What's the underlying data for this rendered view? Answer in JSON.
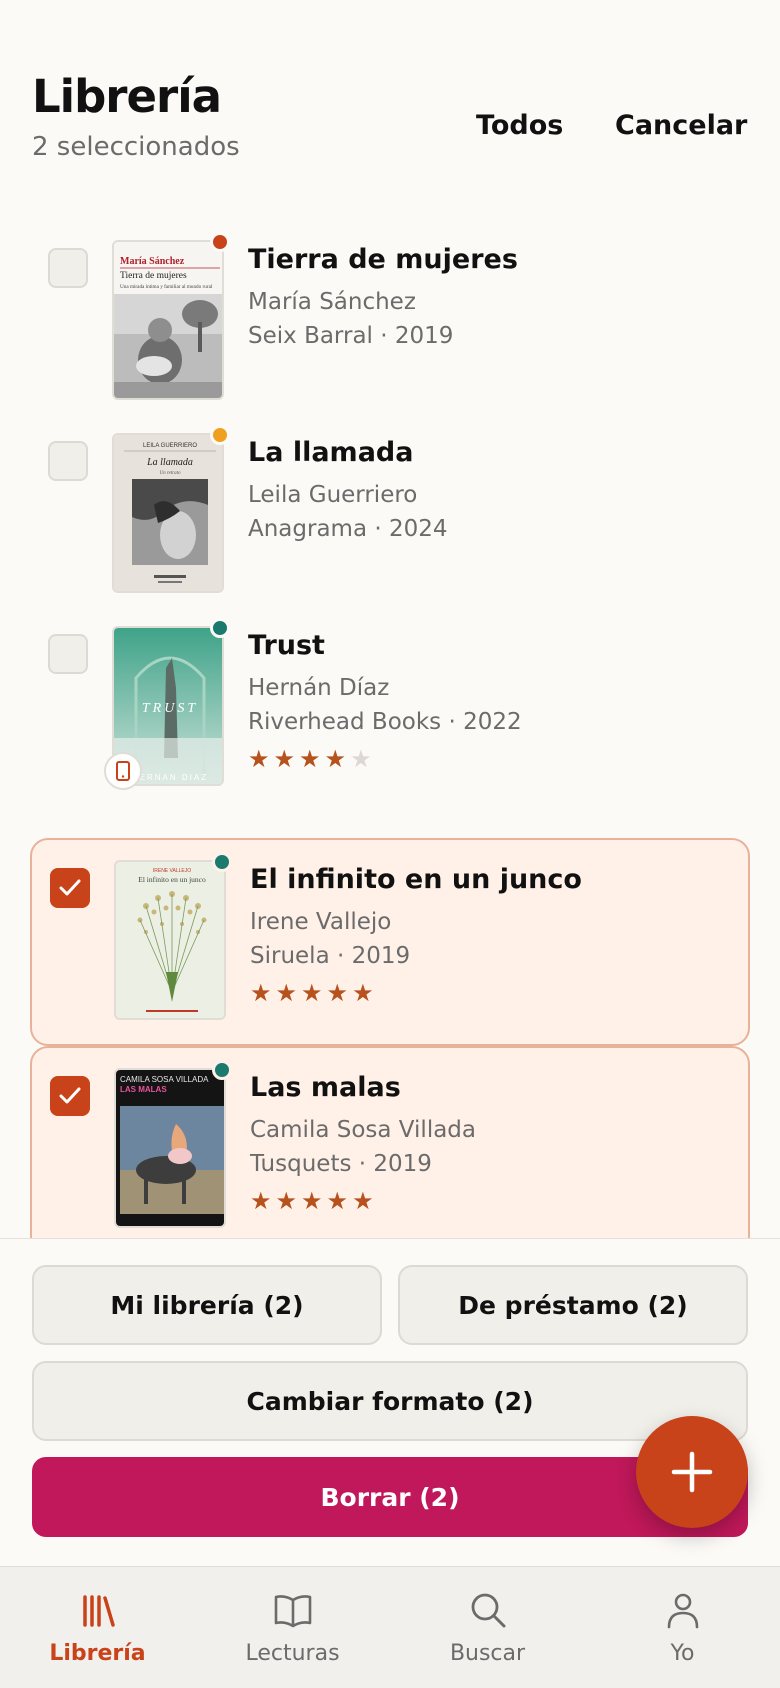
{
  "header": {
    "title": "Librería",
    "subtitle": "2 seleccionados",
    "select_all_label": "Todos",
    "cancel_label": "Cancelar"
  },
  "books": [
    {
      "title": "Tierra de mujeres",
      "author": "María Sánchez",
      "publisher_year": "Seix Barral · 2019",
      "selected": false,
      "status_color": "#c8421a",
      "rating": null,
      "cover_title": "Tierra de mujeres",
      "cover_author": "María Sánchez",
      "cover_subtitle": "Una mirada íntima y familiar al mundo rural"
    },
    {
      "title": "La llamada",
      "author": "Leila Guerriero",
      "publisher_year": "Anagrama · 2024",
      "selected": false,
      "status_color": "#f0a020",
      "rating": null,
      "cover_author": "LEILA GUERRIERO",
      "cover_title": "La llamada",
      "cover_subtitle": "Un retrato"
    },
    {
      "title": "Trust",
      "author": "Hernán Díaz",
      "publisher_year": "Riverhead Books · 2022",
      "selected": false,
      "status_color": "#1a7a6e",
      "rating": 4,
      "has_device_badge": true,
      "cover_title": "TRUST",
      "cover_author": "HERNAN DIAZ"
    },
    {
      "title": "El infinito en un junco",
      "author": "Irene Vallejo",
      "publisher_year": "Siruela · 2019",
      "selected": true,
      "status_color": "#1a7a6e",
      "rating": 5,
      "cover_author": "IRENE VALLEJO",
      "cover_title": "El infinito en un junco"
    },
    {
      "title": "Las malas",
      "author": "Camila Sosa Villada",
      "publisher_year": "Tusquets · 2019",
      "selected": true,
      "status_color": "#1a7a6e",
      "rating": 5,
      "cover_author": "CAMILA SOSA VILLADA",
      "cover_title": "LAS MALAS"
    }
  ],
  "actions": {
    "my_library": "Mi librería (2)",
    "on_loan": "De préstamo (2)",
    "change_format": "Cambiar formato (2)",
    "delete": "Borrar (2)"
  },
  "fab": {
    "icon": "plus-icon"
  },
  "tabs": [
    {
      "label": "Librería",
      "icon": "library-icon",
      "active": true
    },
    {
      "label": "Lecturas",
      "icon": "book-open-icon",
      "active": false
    },
    {
      "label": "Buscar",
      "icon": "search-icon",
      "active": false
    },
    {
      "label": "Yo",
      "icon": "user-icon",
      "active": false
    }
  ],
  "colors": {
    "accent": "#c8421a",
    "delete": "#c0185a",
    "selected_bg": "#fff1e8",
    "star": "#b5521d"
  }
}
